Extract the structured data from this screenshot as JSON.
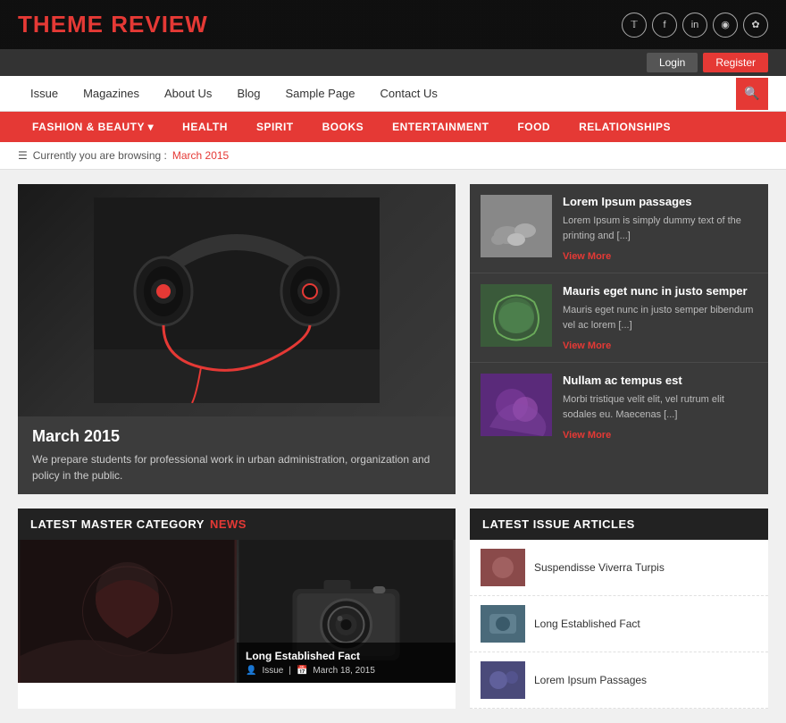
{
  "site": {
    "title_part1": "THEME ",
    "title_part2": "REVIEW"
  },
  "auth": {
    "login": "Login",
    "register": "Register"
  },
  "primary_nav": {
    "items": [
      "Issue",
      "Magazines",
      "About Us",
      "Blog",
      "Sample Page",
      "Contact Us"
    ]
  },
  "category_nav": {
    "items": [
      "FASHION & BEAUTY ▾",
      "HEALTH",
      "SPIRIT",
      "BOOKS",
      "ENTERTAINMENT",
      "FOOD",
      "RELATIONSHIPS"
    ]
  },
  "breadcrumb": {
    "label": "Currently you are browsing :",
    "current": "March 2015"
  },
  "featured": {
    "tag": "MARCH 2015",
    "title": "March 2015",
    "description": "We prepare students for professional work in urban administration, organization and policy in the public."
  },
  "sidebar_articles": [
    {
      "title": "Lorem Ipsum passages",
      "excerpt": "Lorem Ipsum is simply dummy text of the printing and [...]",
      "view_more": "View More"
    },
    {
      "title": "Mauris eget nunc in justo semper",
      "excerpt": "Mauris eget nunc in justo semper bibendum vel ac lorem [...]",
      "view_more": "View More"
    },
    {
      "title": "Nullam ac tempus est",
      "excerpt": "Morbi tristique velit elit, vel rutrum elit sodales eu. Maecenas [...]",
      "view_more": "View More"
    }
  ],
  "latest_master": {
    "section_label1": "LATEST MASTER CATEGORY",
    "section_label2": "NEWS",
    "items": [
      {
        "title": "",
        "caption": ""
      },
      {
        "title": "Long Established Fact",
        "issue": "Issue",
        "date": "March 18, 2015"
      }
    ]
  },
  "latest_issue": {
    "section_label": "LATEST ISSUE ARTICLES",
    "items": [
      {
        "title": "Suspendisse Viverra Turpis"
      },
      {
        "title": "Long Established Fact"
      },
      {
        "title": "Lorem Ipsum Passages"
      }
    ]
  },
  "social_icons": [
    "𝕏",
    "f",
    "in",
    "◎",
    "☆"
  ],
  "icons": {
    "search": "🔍",
    "grid": "⊞",
    "user": "👤",
    "calendar": "📅"
  }
}
